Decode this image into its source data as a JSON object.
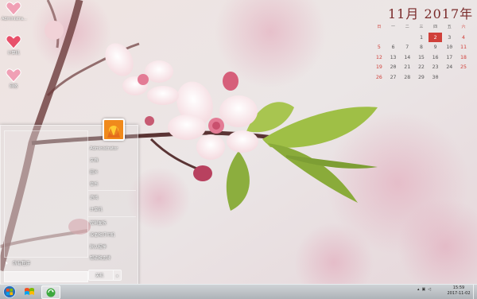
{
  "desktop": {
    "icons": [
      {
        "label": "Administra..."
      },
      {
        "label": "计算机"
      },
      {
        "label": "网络"
      }
    ]
  },
  "calendar": {
    "title": "11月 2017年",
    "weekdays": [
      "日",
      "一",
      "二",
      "三",
      "四",
      "五",
      "六"
    ],
    "weeks": [
      [
        "",
        "",
        "",
        "1",
        "2",
        "3",
        "4"
      ],
      [
        "5",
        "6",
        "7",
        "8",
        "9",
        "10",
        "11"
      ],
      [
        "12",
        "13",
        "14",
        "15",
        "16",
        "17",
        "18"
      ],
      [
        "19",
        "20",
        "21",
        "22",
        "23",
        "24",
        "25"
      ],
      [
        "26",
        "27",
        "28",
        "29",
        "30",
        "",
        ""
      ]
    ],
    "today": "2",
    "accent_color": "#d0403a"
  },
  "start_menu": {
    "user_name": "Administrator",
    "items": [
      "文档",
      "图片",
      "音乐",
      "游戏",
      "计算机",
      "控制面板",
      "设备和打印机",
      "默认程序",
      "帮助和支持"
    ],
    "all_programs": "所有程序",
    "shutdown_label": "关机"
  },
  "taskbar": {
    "clock_time": "15:59",
    "clock_date": "2017-11-02"
  }
}
